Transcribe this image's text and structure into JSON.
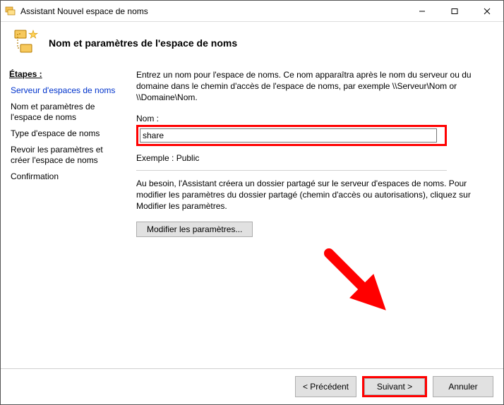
{
  "window": {
    "title": "Assistant Nouvel espace de noms"
  },
  "header": {
    "title": "Nom et paramètres de l'espace de noms"
  },
  "sidebar": {
    "heading": "Étapes :",
    "steps": [
      {
        "label": "Serveur d'espaces de noms"
      },
      {
        "label": "Nom et paramètres de l'espace de noms"
      },
      {
        "label": "Type d'espace de noms"
      },
      {
        "label": "Revoir les paramètres et créer l'espace de noms"
      },
      {
        "label": "Confirmation"
      }
    ]
  },
  "main": {
    "instruction": "Entrez un nom pour l'espace de noms. Ce nom apparaîtra après le nom du serveur ou du domaine dans le chemin d'accès de l'espace de noms, par exemple \\\\Serveur\\Nom or \\\\Domaine\\Nom.",
    "name_label": "Nom :",
    "name_value": "share",
    "example": "Exemple : Public",
    "help": "Au besoin, l'Assistant créera un dossier partagé sur le serveur d'espaces de noms. Pour modifier les paramètres du dossier partagé (chemin d'accès ou autorisations), cliquez sur Modifier les paramètres.",
    "modify_button": "Modifier les paramètres..."
  },
  "footer": {
    "previous": "< Précédent",
    "next": "Suivant >",
    "cancel": "Annuler"
  },
  "colors": {
    "highlight": "#ff0000",
    "link": "#0033cc"
  }
}
